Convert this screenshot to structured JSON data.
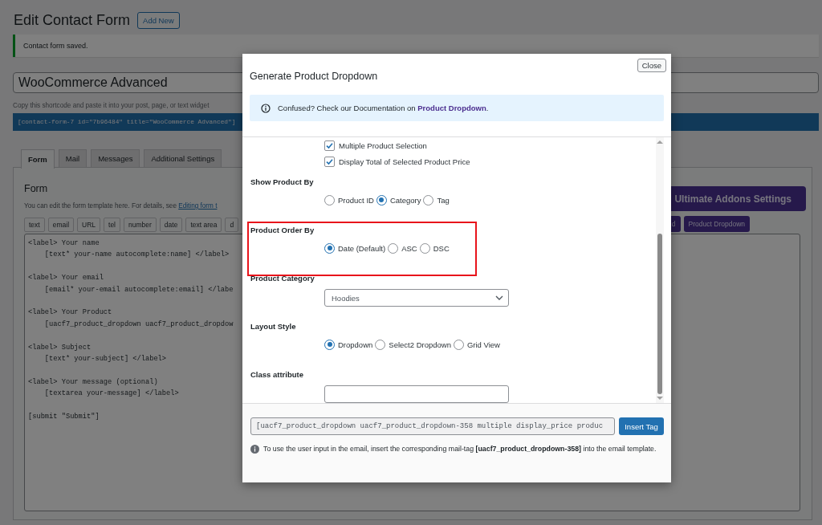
{
  "page": {
    "title": "Edit Contact Form",
    "add_new": "Add New",
    "notice": "Contact form saved.",
    "form_title": "WooCommerce Advanced",
    "shortcode_hint": "Copy this shortcode and paste it into your post, page, or text widget",
    "shortcode": "[contact-form-7 id=\"7b96484\" title=\"WooCommerce Advanced\"]"
  },
  "tabs": [
    {
      "label": "Form",
      "selected": true
    },
    {
      "label": "Mail",
      "selected": false
    },
    {
      "label": "Messages",
      "selected": false
    },
    {
      "label": "Additional Settings",
      "selected": false
    }
  ],
  "form_panel": {
    "heading": "Form",
    "description": "You can edit the form template here. For details, see ",
    "description_link": "Editing form t",
    "tag_buttons": [
      "text",
      "email",
      "URL",
      "tel",
      "number",
      "date",
      "text area",
      "d"
    ],
    "addons_button": "Ultimate Addons Settings",
    "addon_tag_buttons": [
      "d",
      "Product Dropdown"
    ],
    "template_blocks": [
      [
        "<label> Your name",
        "    [text* your-name autocomplete:name] </label>"
      ],
      [
        "<label> Your email",
        "    [email* your-email autocomplete:email] </labe"
      ],
      [
        "<label> Your Product",
        "    [uacf7_product_dropdown uacf7_product_dropdow"
      ],
      [
        "<label> Subject",
        "    [text* your-subject] </label>"
      ],
      [
        "<label> Your message (optional)",
        "    [textarea your-message] </label>"
      ],
      [
        "[submit \"Submit\"]"
      ]
    ]
  },
  "dialog": {
    "title": "Generate Product Dropdown",
    "close": "Close",
    "info_text": "Confused? Check our Documentation on ",
    "info_link": "Product Dropdown",
    "info_end": ".",
    "options": [
      {
        "kind": "checkbox",
        "label": "Multiple Product Selection",
        "checked": true
      },
      {
        "kind": "checkbox",
        "label": "Display Total of Selected Product Price",
        "checked": true
      },
      {
        "kind": "radio_group",
        "label": "Show Product By",
        "highlighted": false,
        "options": [
          {
            "label": "Product ID",
            "selected": false
          },
          {
            "label": "Category",
            "selected": true
          },
          {
            "label": "Tag",
            "selected": false
          }
        ]
      },
      {
        "kind": "radio_group",
        "label": "Product Order By",
        "highlighted": true,
        "options": [
          {
            "label": "Date (Default)",
            "selected": true
          },
          {
            "label": "ASC",
            "selected": false
          },
          {
            "label": "DSC",
            "selected": false
          }
        ]
      },
      {
        "kind": "select",
        "label": "Product Category",
        "value": "Hoodies"
      },
      {
        "kind": "radio_group",
        "label": "Layout Style",
        "highlighted": false,
        "options": [
          {
            "label": "Dropdown",
            "selected": true
          },
          {
            "label": "Select2 Dropdown",
            "selected": false
          },
          {
            "label": "Grid View",
            "selected": false
          }
        ]
      },
      {
        "kind": "text",
        "label": "Class attribute"
      }
    ],
    "tag_code": "[uacf7_product_dropdown uacf7_product_dropdown-358 multiple display_price produc",
    "insert_button": "Insert Tag",
    "note": "To use the user input in the email, insert the corresponding mail-tag **[uacf7_product_dropdown-358]** into the email template."
  }
}
